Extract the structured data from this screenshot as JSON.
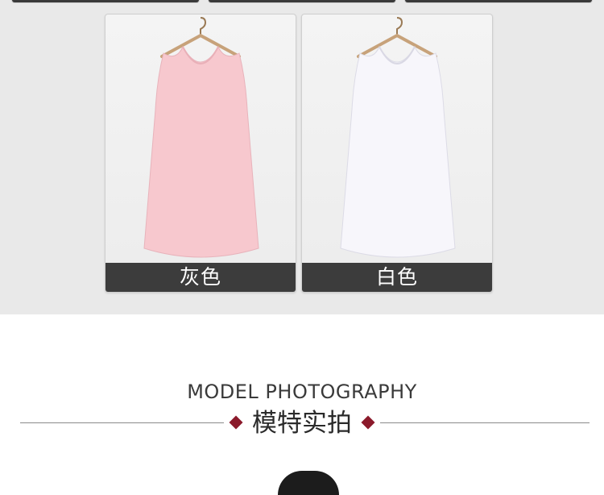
{
  "products": [
    {
      "color_name": "灰色",
      "dress_color": "#f7c8ce"
    },
    {
      "color_name": "白色",
      "dress_color": "#f7f6fb"
    }
  ],
  "section": {
    "title_en": "MODEL PHOTOGRAPHY",
    "title_cn": "模特实拍"
  },
  "colors": {
    "label_bg": "#3c3c3c",
    "accent_diamond": "#8b1a2b",
    "grey_background": "#e9e9e9"
  }
}
